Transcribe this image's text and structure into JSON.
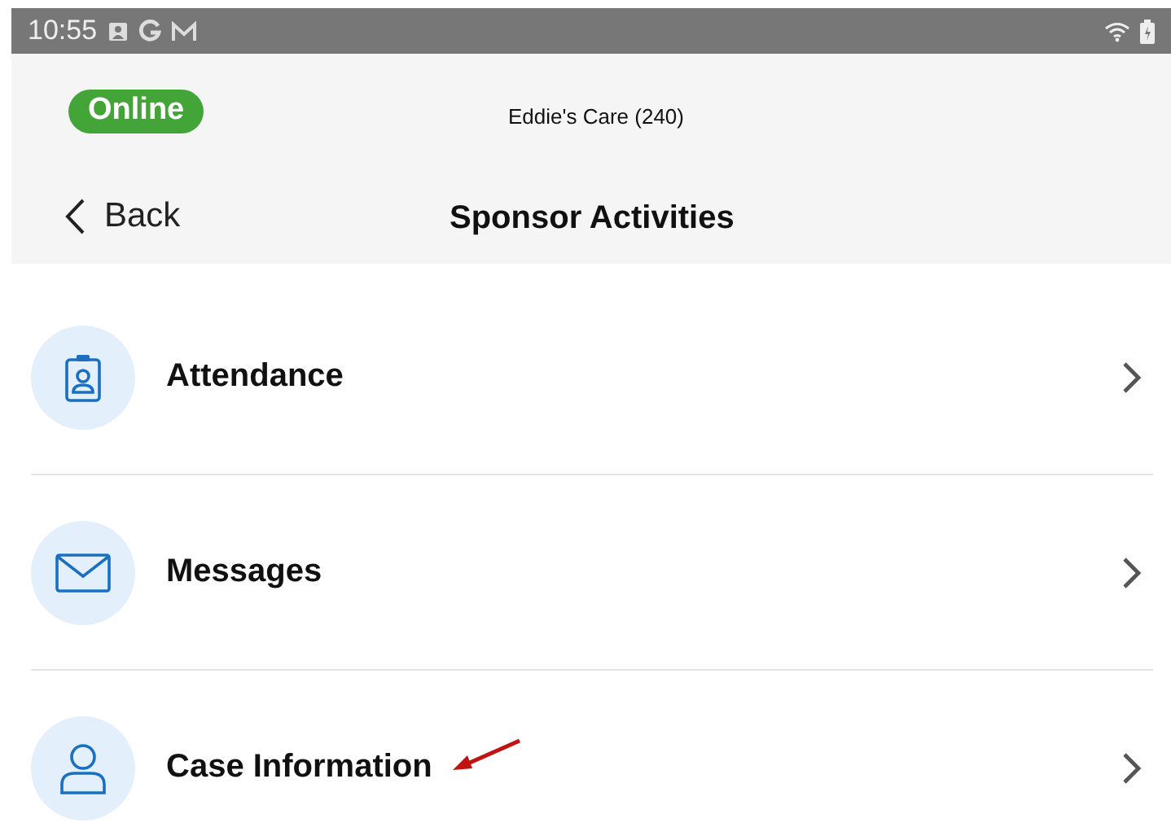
{
  "status_bar": {
    "time": "10:55"
  },
  "header": {
    "status_badge": "Online",
    "site": "Eddie's Care (240)",
    "back": "Back",
    "title": "Sponsor Activities"
  },
  "items": [
    {
      "kind": "clipboard",
      "label": "Attendance",
      "annotated": false
    },
    {
      "kind": "envelope",
      "label": "Messages",
      "annotated": false
    },
    {
      "kind": "person",
      "label": "Case Information",
      "annotated": true
    }
  ]
}
